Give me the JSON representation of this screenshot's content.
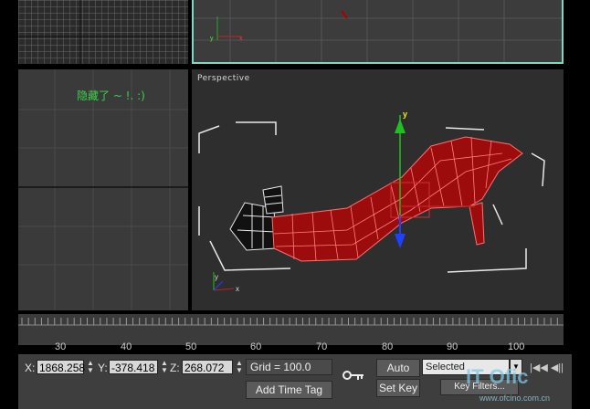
{
  "viewports": {
    "perspective_label": "Perspective",
    "left_note": "隐藏了 ~ !. :)"
  },
  "timeline": {
    "ticks": [
      "30",
      "40",
      "50",
      "60",
      "70",
      "80",
      "90",
      "100"
    ]
  },
  "status": {
    "x_label": "X:",
    "x_value": "1868.258",
    "y_label": "Y:",
    "y_value": "-378.418",
    "z_label": "Z:",
    "z_value": "268.072",
    "grid": "Grid = 100.0",
    "add_time_tag": "Add Time Tag",
    "auto_key": "Auto Key",
    "set_key": "Set Key",
    "selection_dropdown": "Selected",
    "key_filters": "Key Filters..."
  },
  "watermark": {
    "brand": "IT Ofic",
    "url": "www.ofcino.com.cn"
  },
  "colors": {
    "model_red": "#a01010",
    "model_outline": "#ff6060",
    "selection_border": "#7fd8c0",
    "axis_green": "#20c020",
    "axis_blue": "#2040ff"
  }
}
